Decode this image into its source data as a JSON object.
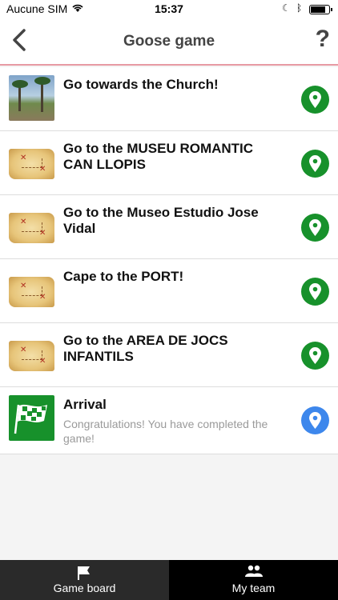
{
  "status_bar": {
    "carrier": "Aucune SIM",
    "time": "15:37",
    "battery_level": 0.85
  },
  "nav": {
    "title": "Goose game",
    "help_label": "?"
  },
  "steps": [
    {
      "title": "Go towards the Church!",
      "subtitle": "",
      "thumb": "photo",
      "pin_color": "#17912b"
    },
    {
      "title": "Go to the MUSEU ROMANTIC CAN LLOPIS",
      "subtitle": "",
      "thumb": "treasure-map",
      "pin_color": "#17912b"
    },
    {
      "title": "Go to the Museo Estudio Jose Vidal",
      "subtitle": "",
      "thumb": "treasure-map",
      "pin_color": "#17912b"
    },
    {
      "title": "Cape to the PORT!",
      "subtitle": "",
      "thumb": "treasure-map",
      "pin_color": "#17912b"
    },
    {
      "title": "Go to the AREA DE JOCS INFANTILS",
      "subtitle": "",
      "thumb": "treasure-map",
      "pin_color": "#17912b"
    },
    {
      "title": "Arrival",
      "subtitle": "Congratulations! You have completed the game!",
      "thumb": "checkered-flag",
      "pin_color": "#3d87ec"
    }
  ],
  "tabbar": {
    "tabs": [
      {
        "label": "Game board",
        "icon": "flag-icon",
        "active": true
      },
      {
        "label": "My team",
        "icon": "people-icon",
        "active": false
      }
    ]
  }
}
